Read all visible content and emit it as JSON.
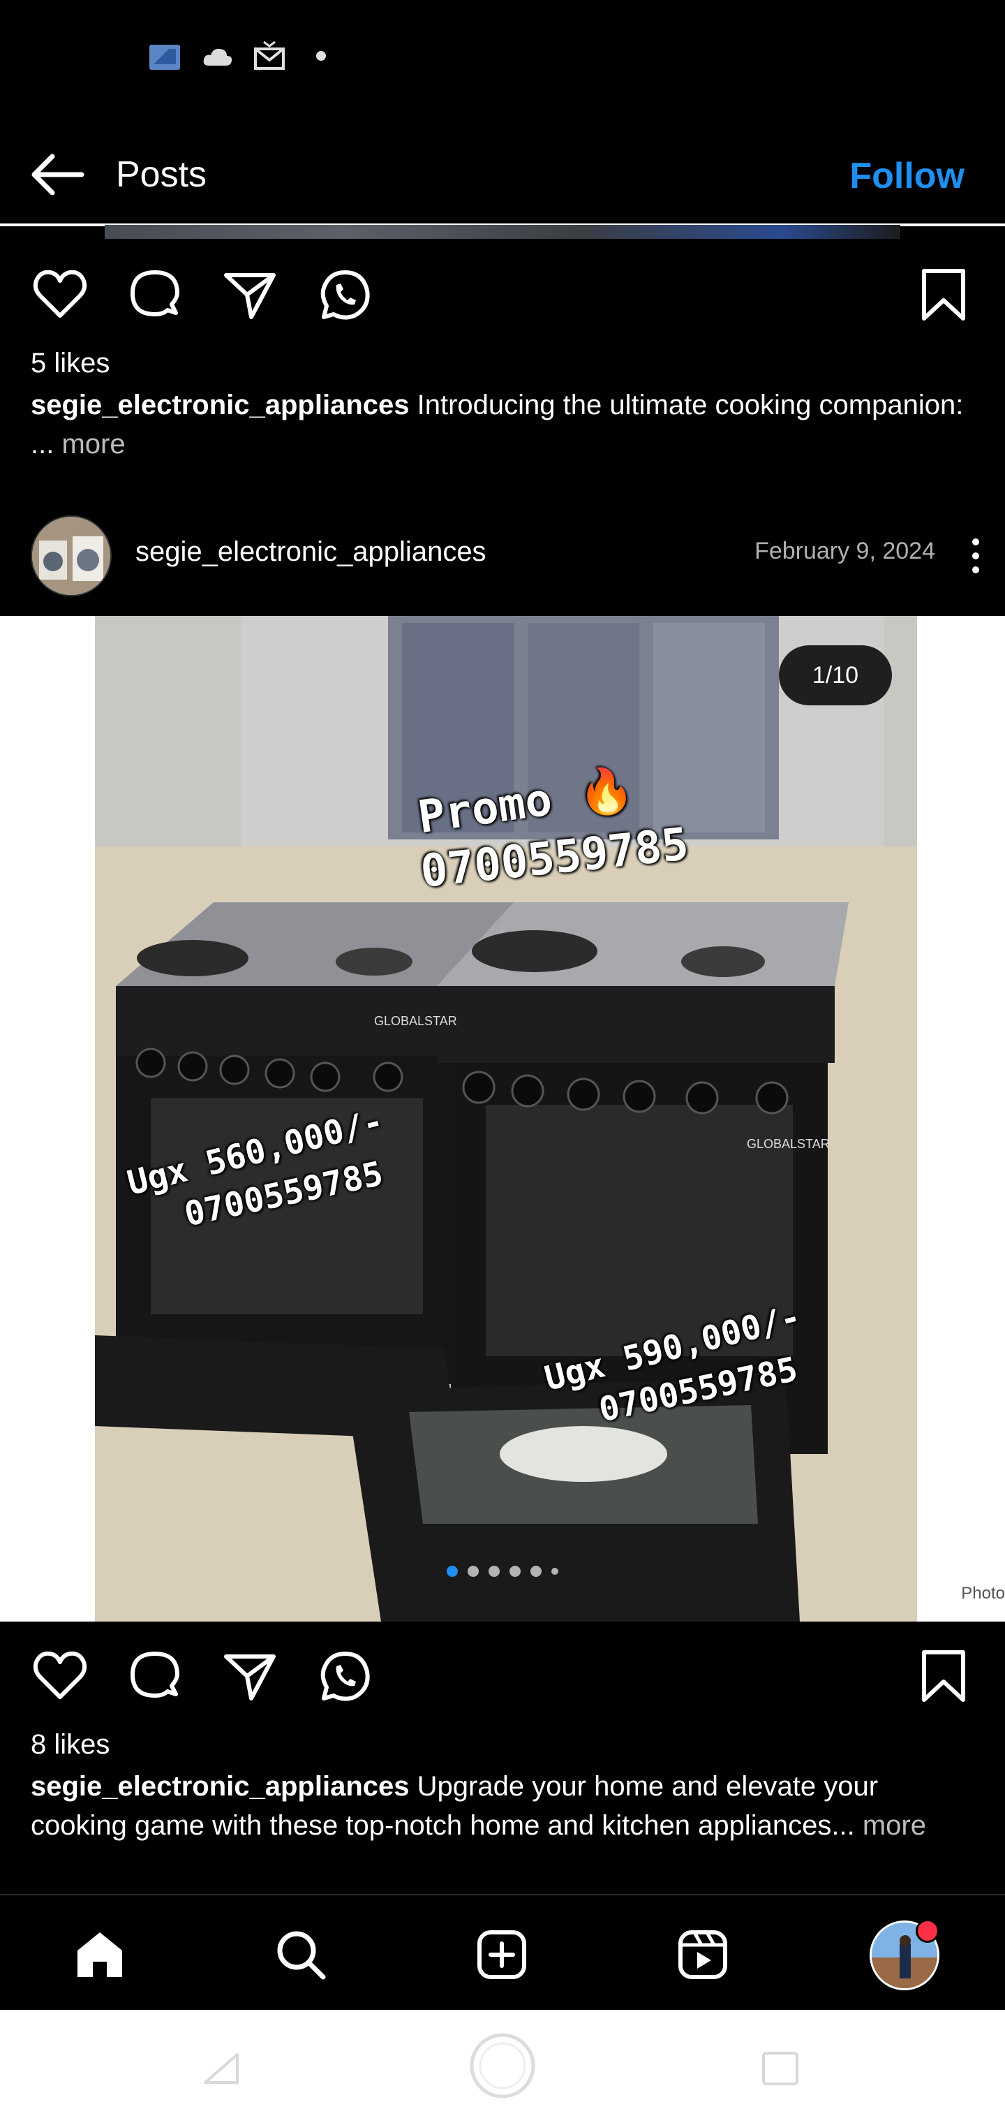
{
  "status_bar": {
    "icons": [
      "sim-card-icon",
      "cloud-icon",
      "mail-icon",
      "dot-icon"
    ]
  },
  "header": {
    "back_icon": "arrow-left-icon",
    "title": "Posts",
    "follow_label": "Follow",
    "follow_color": "#1f8ff0"
  },
  "post1": {
    "actions": [
      "heart-icon",
      "comment-icon",
      "share-icon",
      "whatsapp-icon",
      "bookmark-icon"
    ],
    "likes": "5 likes",
    "username": "segie_electronic_appliances",
    "caption": "Introducing the ultimate cooking companion: ...",
    "more": "more"
  },
  "post2": {
    "username": "segie_electronic_appliances",
    "date": "February 9, 2024",
    "counter": "1/10",
    "overlay": {
      "promo": "Promo 🔥",
      "promo_phone": "0700559785",
      "price_left": "Ugx 560,000/-",
      "price_left_phone": "0700559785",
      "price_right": "Ugx 590,000/-",
      "price_right_phone": "0700559785",
      "brand": "GLOBALSTAR"
    },
    "photo_credit": "Photo",
    "active_slide": 1,
    "total_dots_visible": 6,
    "actions": [
      "heart-icon",
      "comment-icon",
      "share-icon",
      "whatsapp-icon",
      "bookmark-icon"
    ],
    "likes": "8 likes",
    "caption_username": "segie_electronic_appliances",
    "caption": "Upgrade your home and elevate your cooking game with these top-notch home and kitchen appliances...",
    "more": "more"
  },
  "bottom_nav": {
    "items": [
      "home-icon",
      "search-icon",
      "create-icon",
      "reels-icon",
      "profile-avatar"
    ],
    "notification_color": "#ff2f45"
  },
  "system_nav": {
    "items": [
      "back-triangle-icon",
      "home-circle-icon",
      "recents-square-icon"
    ]
  }
}
